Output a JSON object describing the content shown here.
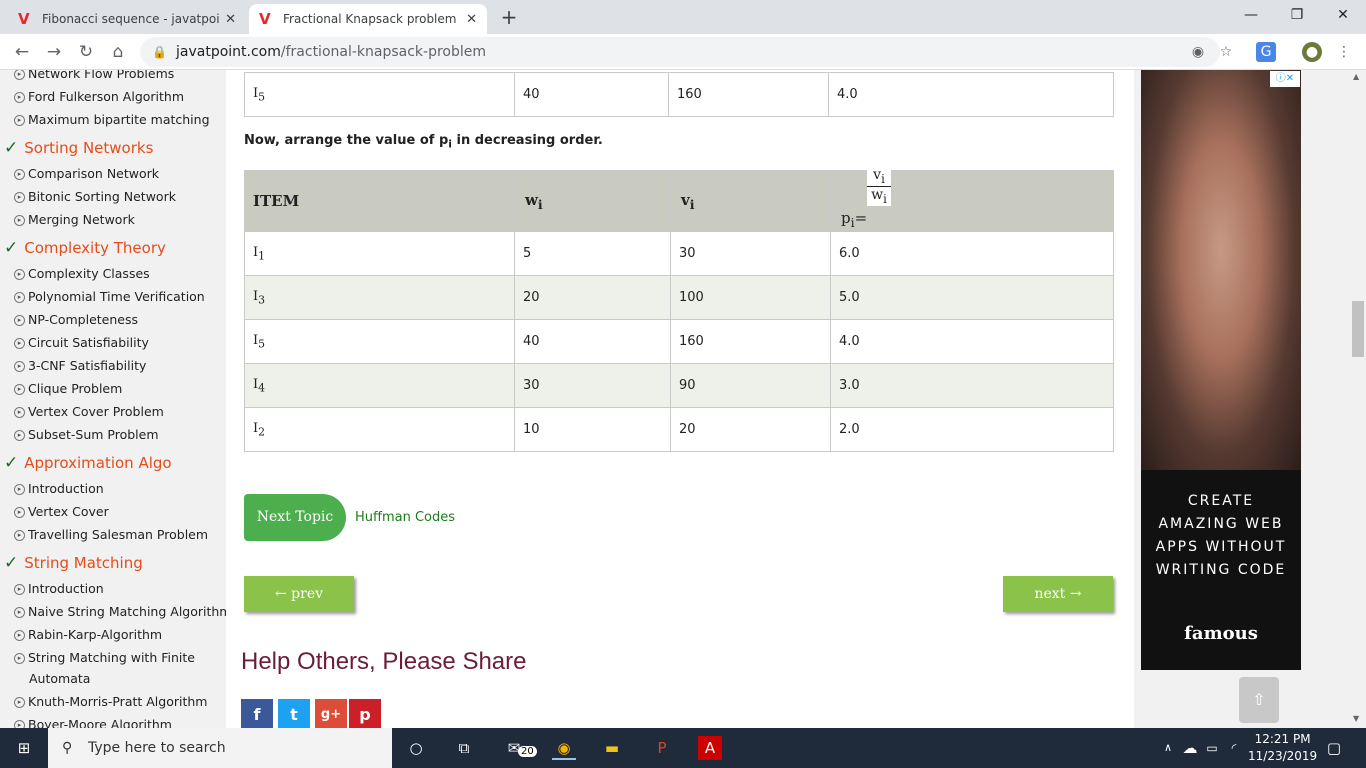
{
  "browser": {
    "tabs": [
      {
        "title": "Fibonacci sequence - javatpoint",
        "favicon": "V"
      },
      {
        "title": "Fractional Knapsack problem - ja",
        "favicon": "V"
      }
    ],
    "url_domain": "javatpoint.com",
    "url_path": "/fractional-knapsack-problem"
  },
  "sidebar": {
    "items": [
      {
        "type": "item",
        "label": "Network Flow Problems"
      },
      {
        "type": "item",
        "label": "Ford Fulkerson Algorithm"
      },
      {
        "type": "item",
        "label": "Maximum bipartite matching"
      },
      {
        "type": "head",
        "label": "Sorting Networks"
      },
      {
        "type": "item",
        "label": "Comparison Network"
      },
      {
        "type": "item",
        "label": "Bitonic Sorting Network"
      },
      {
        "type": "item",
        "label": "Merging Network"
      },
      {
        "type": "head",
        "label": "Complexity Theory"
      },
      {
        "type": "item",
        "label": "Complexity Classes"
      },
      {
        "type": "item",
        "label": "Polynomial Time Verification"
      },
      {
        "type": "item",
        "label": "NP-Completeness"
      },
      {
        "type": "item",
        "label": "Circuit Satisfiability"
      },
      {
        "type": "item",
        "label": "3-CNF Satisfiability"
      },
      {
        "type": "item",
        "label": "Clique Problem"
      },
      {
        "type": "item",
        "label": "Vertex Cover Problem"
      },
      {
        "type": "item",
        "label": "Subset-Sum Problem"
      },
      {
        "type": "head",
        "label": "Approximation Algo"
      },
      {
        "type": "item",
        "label": "Introduction"
      },
      {
        "type": "item",
        "label": "Vertex Cover"
      },
      {
        "type": "item",
        "label": "Travelling Salesman Problem"
      },
      {
        "type": "head",
        "label": "String Matching"
      },
      {
        "type": "item",
        "label": "Introduction"
      },
      {
        "type": "item",
        "label": "Naive String Matching Algorithm"
      },
      {
        "type": "item",
        "label": "Rabin-Karp-Algorithm"
      },
      {
        "type": "item",
        "label": "String Matching with Finite"
      },
      {
        "type": "cont",
        "label": "Automata"
      },
      {
        "type": "item",
        "label": "Knuth-Morris-Pratt Algorithm"
      },
      {
        "type": "item",
        "label": "Boyer-Moore Algorithm"
      }
    ]
  },
  "main": {
    "top_row": [
      "I",
      "5",
      "40",
      "160",
      "4.0"
    ],
    "instruction": "Now, arrange the value of p",
    "instruction_sub": "i",
    "instruction_tail": " in decreasing order.",
    "table_header": {
      "item": "ITEM",
      "w": "w",
      "w_sub": "i",
      "v": "v",
      "v_sub": "i",
      "p": "p",
      "p_sub": "i",
      "frac_top": "v",
      "frac_top_sub": "i",
      "frac_bottom": "w",
      "frac_bottom_sub": "i"
    },
    "rows": [
      {
        "item": "I",
        "sub": "1",
        "w": "5",
        "v": "30",
        "p": "6.0"
      },
      {
        "item": "I",
        "sub": "3",
        "w": "20",
        "v": "100",
        "p": "5.0"
      },
      {
        "item": "I",
        "sub": "5",
        "w": "40",
        "v": "160",
        "p": "4.0"
      },
      {
        "item": "I",
        "sub": "4",
        "w": "30",
        "v": "90",
        "p": "3.0"
      },
      {
        "item": "I",
        "sub": "2",
        "w": "10",
        "v": "20",
        "p": "2.0"
      }
    ],
    "next_topic_label": "Next Topic",
    "next_topic_link": "Huffman Codes",
    "prev_label": "← prev",
    "next_label": "next →",
    "share_title": "Help Others, Please Share",
    "share_buttons": [
      "f",
      "t",
      "g+",
      "p"
    ]
  },
  "ad": {
    "lines": [
      "CREATE",
      "AMAZING WEB",
      "APPS WITHOUT",
      "WRITING CODE"
    ],
    "brand": "famous",
    "badge": "ⓘ✕"
  },
  "taskbar": {
    "search_placeholder": "Type here to search",
    "time": "12:21 PM",
    "date": "11/23/2019",
    "mail_badge": "20"
  }
}
